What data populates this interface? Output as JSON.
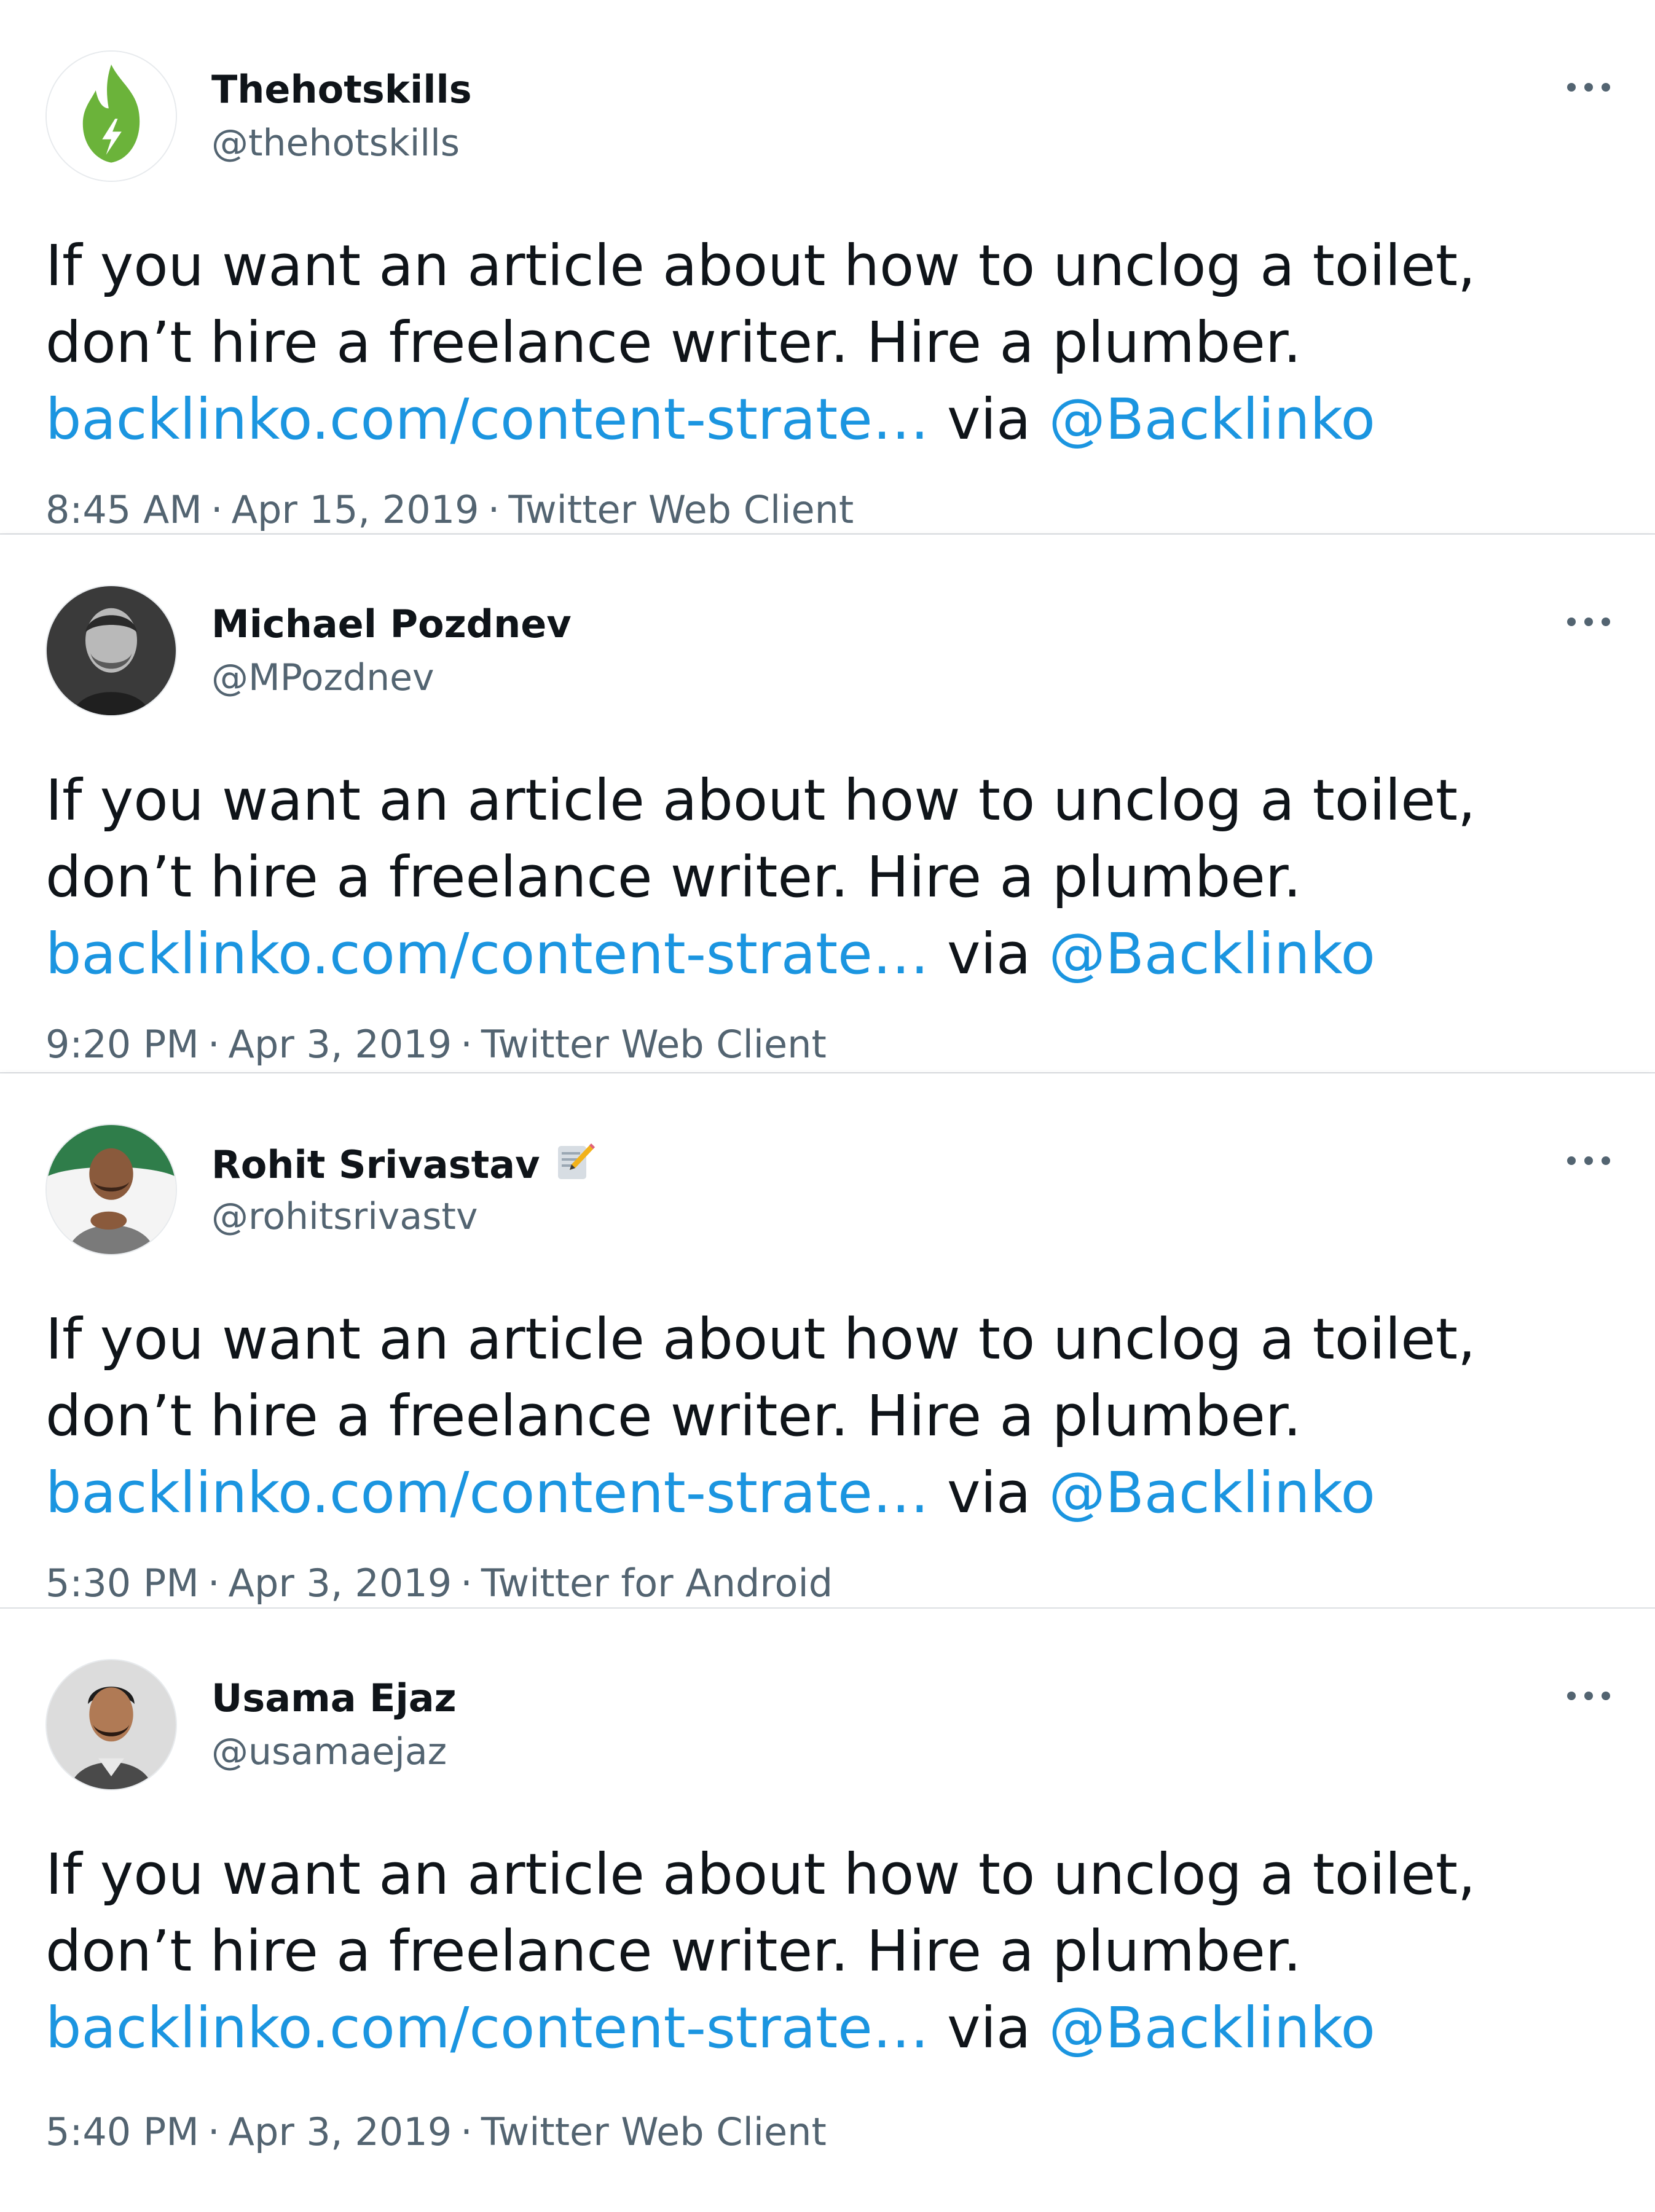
{
  "tweets": [
    {
      "display_name": "Thehotskills",
      "handle": "@thehotskills",
      "avatar_icon": "green-flame-bolt-logo-icon",
      "text_line1": "If you want an article about how to unclog a toilet,",
      "text_line2": "don’t hire a freelance writer. Hire a plumber.",
      "link": "backlinko.com/content-strate…",
      "via": "via",
      "mention": "@Backlinko",
      "time": "8:45 AM",
      "date": "Apr 15, 2019",
      "client": "Twitter Web Client",
      "separator": "·"
    },
    {
      "display_name": "Michael Pozdnev",
      "handle": "@MPozdnev",
      "avatar_icon": "profile-photo-icon",
      "text_line1": "If you want an article about how to unclog a toilet,",
      "text_line2": "don’t hire a freelance writer. Hire a plumber.",
      "link": "backlinko.com/content-strate…",
      "via": "via",
      "mention": "@Backlinko",
      "time": "9:20 PM",
      "date": "Apr 3, 2019",
      "client": "Twitter Web Client",
      "separator": "·"
    },
    {
      "display_name": "Rohit Srivastav",
      "handle": "@rohitsrivastv",
      "avatar_icon": "profile-photo-icon",
      "name_emoji_icon": "memo-pencil-icon",
      "text_line1": "If you want an article about how to unclog a toilet,",
      "text_line2": "don’t hire a freelance writer. Hire a plumber.",
      "link": "backlinko.com/content-strate…",
      "via": "via",
      "mention": "@Backlinko",
      "time": "5:30 PM",
      "date": "Apr 3, 2019",
      "client": "Twitter for Android",
      "separator": "·"
    },
    {
      "display_name": "Usama Ejaz",
      "handle": "@usamaejaz",
      "avatar_icon": "profile-photo-icon",
      "text_line1": "If you want an article about how to unclog a toilet,",
      "text_line2": "don’t hire a freelance writer. Hire a plumber.",
      "link": "backlinko.com/content-strate…",
      "via": "via",
      "mention": "@Backlinko",
      "time": "5:40 PM",
      "date": "Apr 3, 2019",
      "client": "Twitter Web Client",
      "separator": "·"
    }
  ],
  "colors": {
    "link": "#1b95e0",
    "text": "#0f1419",
    "secondary": "#536471",
    "brand_green": "#6bb33a"
  }
}
